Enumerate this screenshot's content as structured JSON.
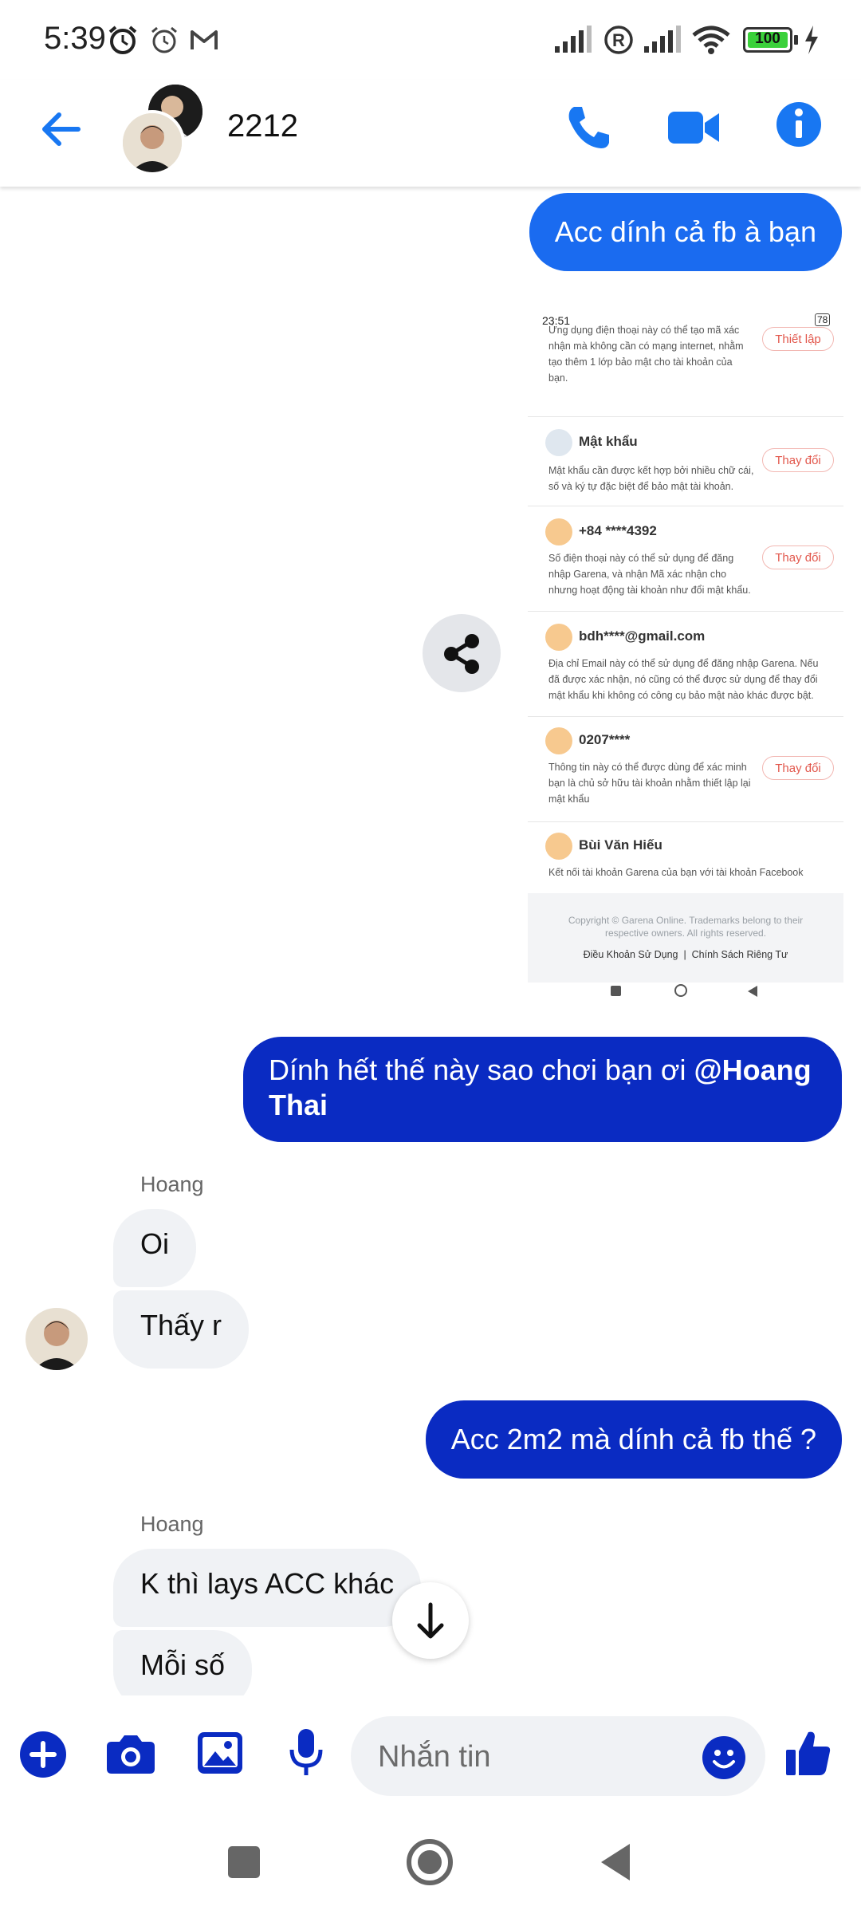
{
  "status_bar": {
    "time": "5:39",
    "battery": "100",
    "icons": [
      "alarm-icon",
      "alarm-outline-icon",
      "gmail-icon",
      "signal-icon",
      "registered-icon",
      "wifi-icon",
      "battery-icon",
      "charging-icon"
    ]
  },
  "header": {
    "title": "2212",
    "back_icon": "back-arrow-icon",
    "actions": [
      "phone-icon",
      "video-icon",
      "info-icon"
    ],
    "accent": "#1877f2"
  },
  "messages": {
    "m1": "Acc dính cả fb à bạn",
    "m2_prefix": "Dính hết thế này sao chơi bạn ơi ",
    "m2_mention_line1": "@Hoang",
    "m2_mention_line2": "Thai",
    "sender1": "Hoang",
    "m3": "Oi",
    "m4": "Thấy r",
    "m5": "Acc 2m2 mà dính cả fb thế ?",
    "sender2": "Hoang",
    "m6": "K thì lays ACC khác",
    "m7": "Mỗi số"
  },
  "shared_image": {
    "status_time": "23:51",
    "battery": "78",
    "top_text_1": "Ứng dụng điện thoại này có thể tạo mã xác",
    "top_text_2": "nhận mà không cần có mạng internet, nhằm",
    "top_text_3": "tạo thêm 1 lớp bảo mật cho tài khoản của",
    "top_text_4": "bạn.",
    "btn_setup": "Thiết lập",
    "password_title": "Mật khẩu",
    "password_desc_1": "Mật khẩu cần được kết hợp bởi nhiều chữ cái,",
    "password_desc_2": "số và ký tự đặc biệt để bảo mật tài khoản.",
    "btn_change": "Thay đổi",
    "phone_title": "+84 ****4392",
    "phone_desc_1": "Số điện thoại này có thể sử dụng để đăng",
    "phone_desc_2": "nhập Garena, và nhận Mã xác nhận cho",
    "phone_desc_3": "nhưng hoạt động tài khoản như đổi mật khẩu.",
    "email_title": "bdh****@gmail.com",
    "email_desc_1": "Địa chỉ Email này có thể sử dụng để đăng nhập Garena. Nếu",
    "email_desc_2": "đã được xác nhận, nó cũng có thể được sử dụng để thay đổi",
    "email_desc_3": "mật khẩu khi không có công cụ bảo mật nào khác được bật.",
    "id_title": "0207****",
    "id_desc_1": "Thông tin này có thể được dùng để xác minh",
    "id_desc_2": "bạn là chủ sở hữu tài khoản nhằm thiết lập lại",
    "id_desc_3": "mật khẩu",
    "fb_title": "Bùi Văn Hiếu",
    "fb_desc": "Kết nối tài khoản Garena của bạn với tài khoản Facebook",
    "copyright_1": "Copyright © Garena Online. Trademarks belong to their",
    "copyright_2": "respective owners. All rights reserved.",
    "terms": "Điều Khoản Sử Dụng",
    "separator": "|",
    "privacy": "Chính Sách Riêng Tư"
  },
  "composer": {
    "placeholder": "Nhắn tin",
    "icons": [
      "plus-icon",
      "camera-icon",
      "gallery-icon",
      "microphone-icon",
      "emoji-icon",
      "thumbs-up-icon"
    ]
  },
  "colors": {
    "bubble_dark": "#0a2bc2",
    "bubble_light": "#1a6bf0",
    "icon_blue": "#0a2bc2"
  }
}
